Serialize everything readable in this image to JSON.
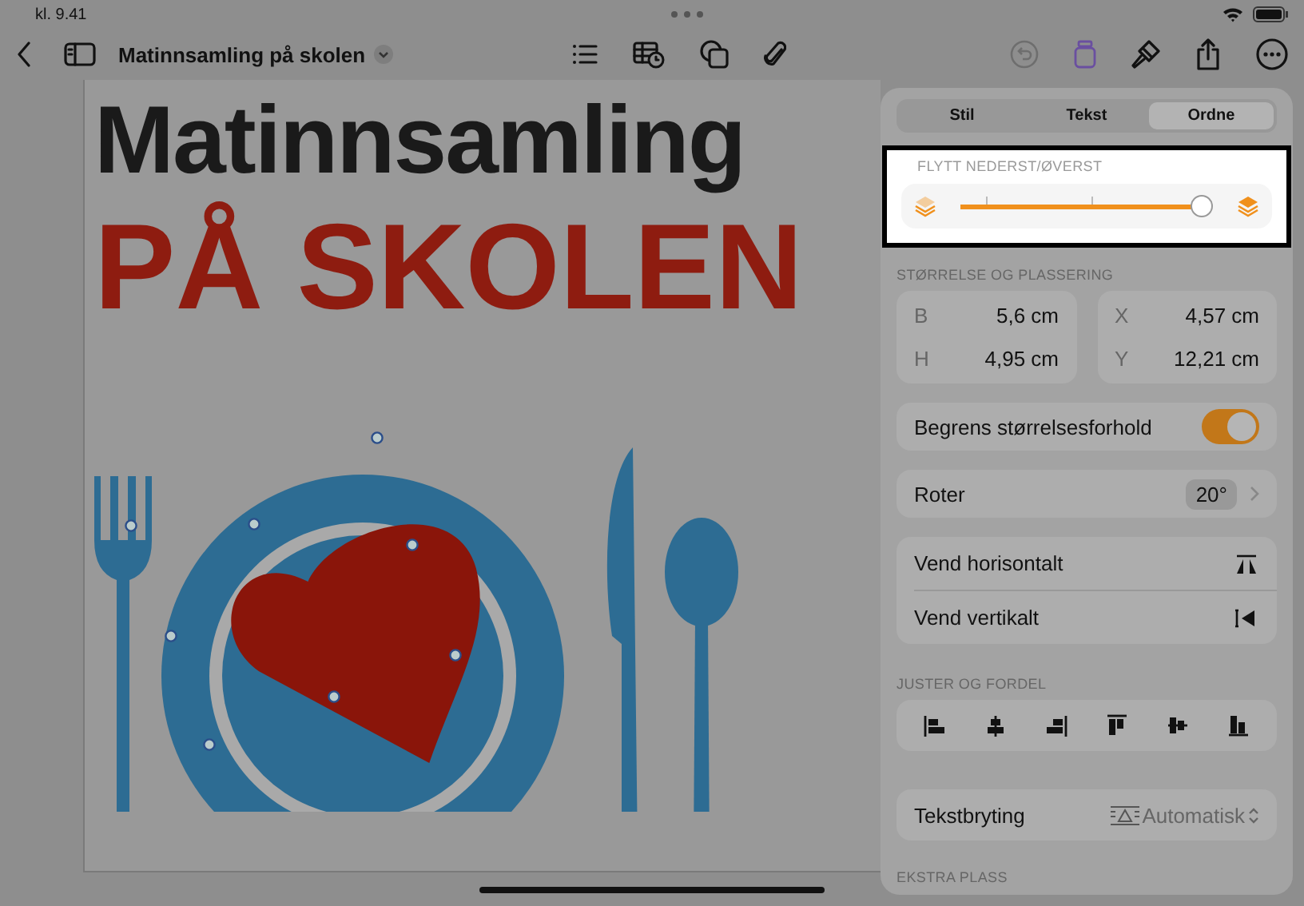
{
  "status_bar": {
    "time": "kl. 9.41"
  },
  "toolbar": {
    "document_title": "Matinnsamling på skolen"
  },
  "document": {
    "heading": "Matinnsamling",
    "subheading": "PÅ SKOLEN"
  },
  "panel": {
    "tabs": [
      {
        "label": "Stil",
        "selected": false
      },
      {
        "label": "Tekst",
        "selected": false
      },
      {
        "label": "Ordne",
        "selected": true
      }
    ],
    "layer": {
      "label": "FLYTT NEDERST/ØVERST",
      "level": 1
    },
    "size_position": {
      "label": "STØRRELSE OG PLASSERING",
      "fields": [
        {
          "label": "B",
          "value": "5,6 cm"
        },
        {
          "label": "H",
          "value": "4,95 cm"
        },
        {
          "label": "X",
          "value": "4,57 cm"
        },
        {
          "label": "Y",
          "value": "12,21 cm"
        }
      ]
    },
    "aspect_lock": {
      "label": "Begrens størrelsesforhold",
      "on": true
    },
    "rotate": {
      "label": "Roter",
      "value": "20°"
    },
    "flip": [
      {
        "label": "Vend horisontalt",
        "kind": "horizontal"
      },
      {
        "label": "Vend vertikalt",
        "kind": "vertical"
      }
    ],
    "align": {
      "label": "JUSTER OG FORDEL"
    },
    "text_wrap": {
      "label": "Tekstbryting",
      "value": "Automatisk"
    },
    "extra_space": {
      "label": "EKSTRA PLASS"
    }
  }
}
